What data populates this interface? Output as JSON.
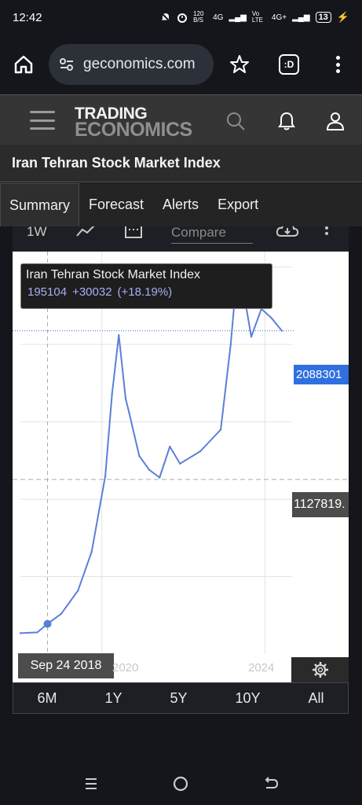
{
  "status_bar": {
    "time": "12:42",
    "net_speed": "120 B/S",
    "signal1": "4G",
    "signal2": "Vo LTE",
    "signal3": "4G+",
    "battery": "13"
  },
  "browser": {
    "url": "geconomics.com",
    "tab_count_label": ":D"
  },
  "site_header": {
    "logo_line1": "TRADING",
    "logo_line2": "ECONOMICS",
    "icons": [
      "menu-icon",
      "search-icon",
      "bell-icon",
      "user-icon"
    ]
  },
  "page": {
    "title": "Iran Tehran Stock Market Index"
  },
  "tabs": [
    {
      "label": "Summary",
      "active": true
    },
    {
      "label": "Forecast",
      "active": false
    },
    {
      "label": "Alerts",
      "active": false
    },
    {
      "label": "Export",
      "active": false
    }
  ],
  "chart_toolbar": {
    "interval": "1W",
    "compare_placeholder": "Compare"
  },
  "tooltip": {
    "name": "Iran Tehran Stock Market Index",
    "value": "195104",
    "change": "+30032",
    "change_pct": "(+18.19%)"
  },
  "price_labels": {
    "last": "2088301",
    "reference": "1127819."
  },
  "chart_data": {
    "type": "line",
    "series": [
      {
        "name": "Iran Tehran Stock Market Index",
        "color": "#5b7fd8",
        "x": [
          "2018-01",
          "2018-06",
          "2018-09",
          "2019-01",
          "2019-06",
          "2019-10",
          "2020-02",
          "2020-04",
          "2020-06",
          "2020-08",
          "2020-09",
          "2020-12",
          "2021-03",
          "2021-06",
          "2021-09",
          "2021-12",
          "2022-06",
          "2022-12",
          "2023-03",
          "2023-05",
          "2023-07",
          "2023-09",
          "2023-12",
          "2024-03",
          "2024-06"
        ],
        "values": [
          135000,
          140000,
          195104,
          260000,
          410000,
          660000,
          1150000,
          1680000,
          2060000,
          1650000,
          1560000,
          1280000,
          1190000,
          1140000,
          1340000,
          1230000,
          1310000,
          1450000,
          2000000,
          2500000,
          2310000,
          2050000,
          2230000,
          2170000,
          2088301
        ]
      }
    ],
    "reference_line": 1127819,
    "selected_point": {
      "date": "Sep 24 2018",
      "value": 195104
    },
    "x_tick_labels": [
      "2020",
      "2024"
    ],
    "ylim": [
      0,
      2600000
    ],
    "grid": true,
    "legend": "none"
  },
  "axis": {
    "selected_date": "Sep 24 2018",
    "tick_2020": "2020",
    "tick_2024": "2024"
  },
  "ranges": [
    "6M",
    "1Y",
    "5Y",
    "10Y",
    "All"
  ]
}
